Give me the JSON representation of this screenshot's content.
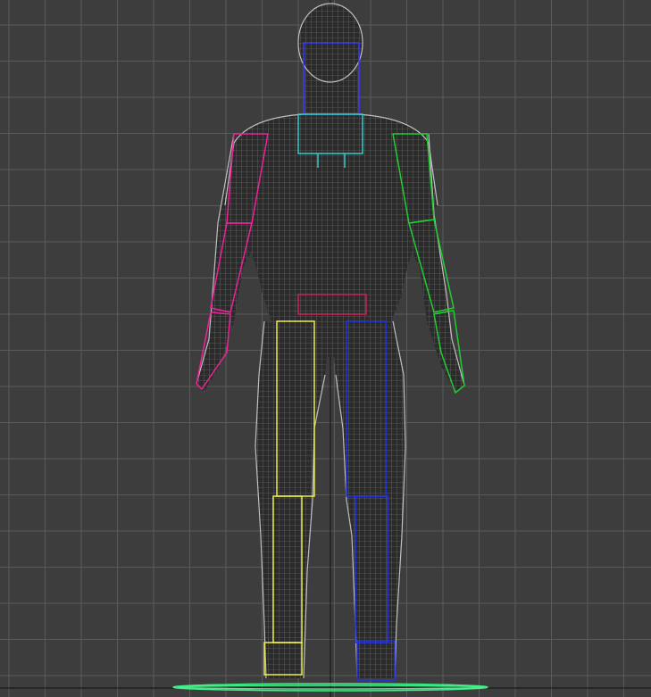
{
  "viewport": {
    "view": "front",
    "grid": "on",
    "background_color": "#3d3d3d",
    "grid_color": "#5a5a5a",
    "axis_color": "#111111"
  },
  "mesh": {
    "object": "human-body-wireframe",
    "wire_color": "#bdbdbd"
  },
  "rig": {
    "parts": [
      {
        "name": "head",
        "color": "#3a3aff"
      },
      {
        "name": "neck-spine",
        "color": "#33cccc"
      },
      {
        "name": "pelvis",
        "color": "#cc2255"
      },
      {
        "name": "left-arm",
        "color": "#22cc33"
      },
      {
        "name": "right-arm",
        "color": "#ee2299"
      },
      {
        "name": "left-leg",
        "color": "#2233ee"
      },
      {
        "name": "right-leg",
        "color": "#eeee44"
      },
      {
        "name": "ground-plane",
        "color": "#44ee88"
      }
    ]
  }
}
